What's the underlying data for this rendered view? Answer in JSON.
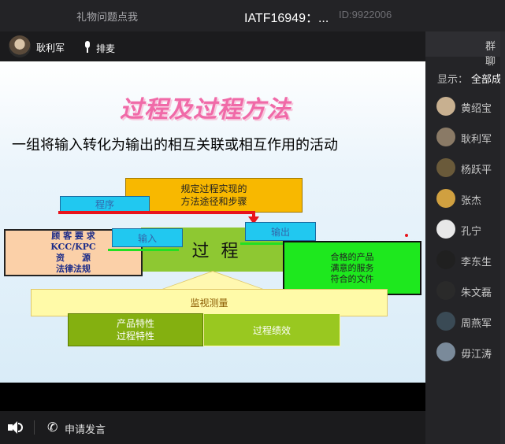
{
  "topbar": {
    "gift_label": "礼物问题点我",
    "title": "IATF16949：...",
    "room_id": "ID:9922006"
  },
  "presenter": {
    "name": "耿利军",
    "queue_label": "排麦"
  },
  "slide": {
    "title": "过程及过程方法",
    "definition": "一组将输入转化为输出的相互关联或相互作用的活动",
    "method_box": [
      "规定过程实现的",
      "方法途径和步骤"
    ],
    "program_label": "程序",
    "customer_box": [
      "顾 客 要 求",
      "KCC/KPC",
      "资　　源",
      "法律法规"
    ],
    "input_label": "输入",
    "process_label": "过 程",
    "output_label": "输出",
    "quality_box": [
      "合格的产品",
      "满意的服务",
      "符合的文件"
    ],
    "monitor_label": "监视测量",
    "char_box": [
      "产品特性",
      "过程特性"
    ],
    "perf_label": "过程绩效"
  },
  "bottombar": {
    "apply_label": "申请发言"
  },
  "panel": {
    "tab_label": "群聊",
    "show_label": "显示：",
    "show_value": "全部成员",
    "members": [
      {
        "name": "黄绍宝",
        "color": "#c8b090"
      },
      {
        "name": "耿利军",
        "color": "#8a7a66"
      },
      {
        "name": "杨跃平",
        "color": "#6a5a3a"
      },
      {
        "name": "张杰",
        "color": "#d0a040"
      },
      {
        "name": "孔宁",
        "color": "#e8e8e8"
      },
      {
        "name": "李东生",
        "color": "#202020"
      },
      {
        "name": "朱文磊",
        "color": "#2a2a2a"
      },
      {
        "name": "周燕军",
        "color": "#3a4a55"
      },
      {
        "name": "毋江涛",
        "color": "#7a8a9a"
      }
    ]
  }
}
